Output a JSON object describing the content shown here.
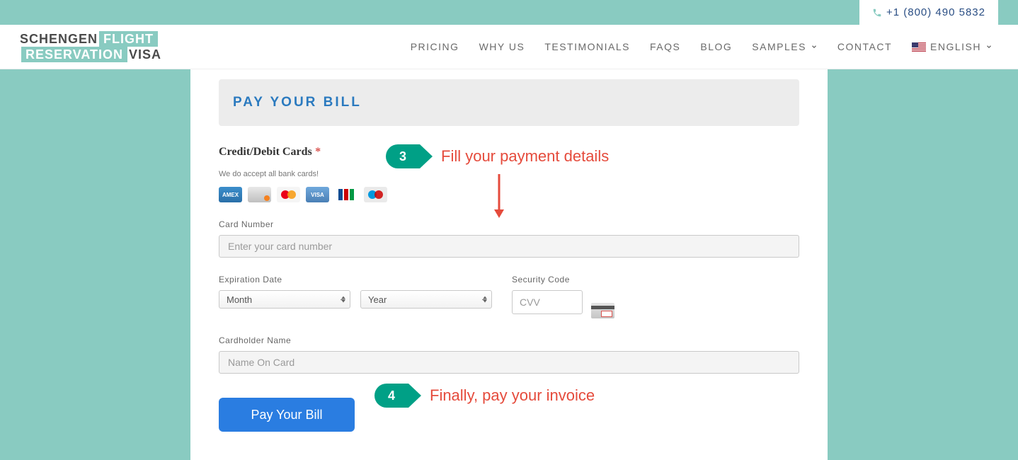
{
  "topbar": {
    "phone": "+1 (800) 490 5832"
  },
  "logo": {
    "w1": "SCHENGEN",
    "w2": "FLIGHT",
    "w3": "RESERVATION",
    "w4": "VISA"
  },
  "nav": {
    "pricing": "PRICING",
    "whyus": "WHY US",
    "testimonials": "TESTIMONIALS",
    "faqs": "FAQS",
    "blog": "BLOG",
    "samples": "SAMPLES",
    "contact": "CONTACT",
    "language": "ENGLISH"
  },
  "section": {
    "heading": "PAY YOUR BILL"
  },
  "form": {
    "cards_label": "Credit/Debit Cards",
    "required_mark": "*",
    "accept_note": "We do accept all bank cards!",
    "card_number_label": "Card Number",
    "card_number_placeholder": "Enter your card number",
    "exp_label": "Expiration Date",
    "month_selected": "Month",
    "year_selected": "Year",
    "sec_label": "Security Code",
    "cvv_placeholder": "CVV",
    "holder_label": "Cardholder Name",
    "holder_placeholder": "Name On Card",
    "submit": "Pay Your Bill"
  },
  "annotations": {
    "step3_num": "3",
    "step3_text": "Fill your payment details",
    "step4_num": "4",
    "step4_text": "Finally, pay your invoice"
  }
}
